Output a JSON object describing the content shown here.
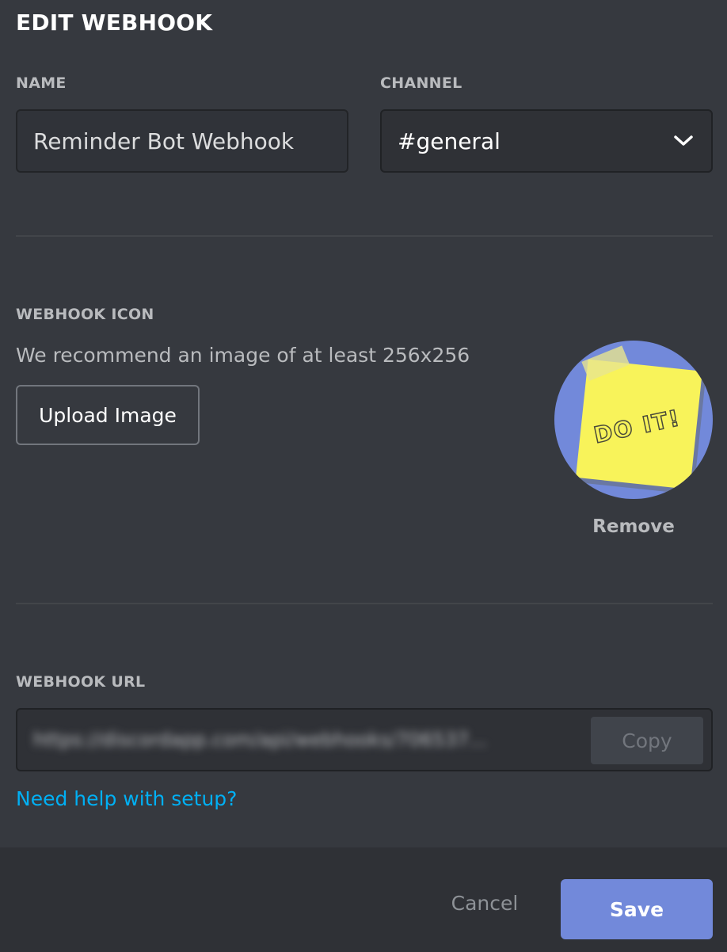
{
  "dialog": {
    "title": "EDIT WEBHOOK"
  },
  "name_field": {
    "label": "NAME",
    "value": "Reminder Bot Webhook"
  },
  "channel_field": {
    "label": "CHANNEL",
    "value": "#general",
    "icon": "chevron-down-icon"
  },
  "icon_section": {
    "label": "WEBHOOK ICON",
    "hint": "We recommend an image of at least 256x256",
    "upload_label": "Upload Image",
    "avatar_text": "DO IT!",
    "remove_label": "Remove",
    "avatar_bg": "#7289da",
    "note_color": "#f8f35a"
  },
  "url_section": {
    "label": "WEBHOOK URL",
    "value": "https://discordapp.com/api/webhooks/706537...",
    "copy_label": "Copy"
  },
  "help_link": "Need help with setup?",
  "footer": {
    "cancel_label": "Cancel",
    "save_label": "Save"
  },
  "colors": {
    "background": "#36393f",
    "footer": "#2f3136",
    "accent": "#7289da",
    "link": "#00b0f4"
  }
}
